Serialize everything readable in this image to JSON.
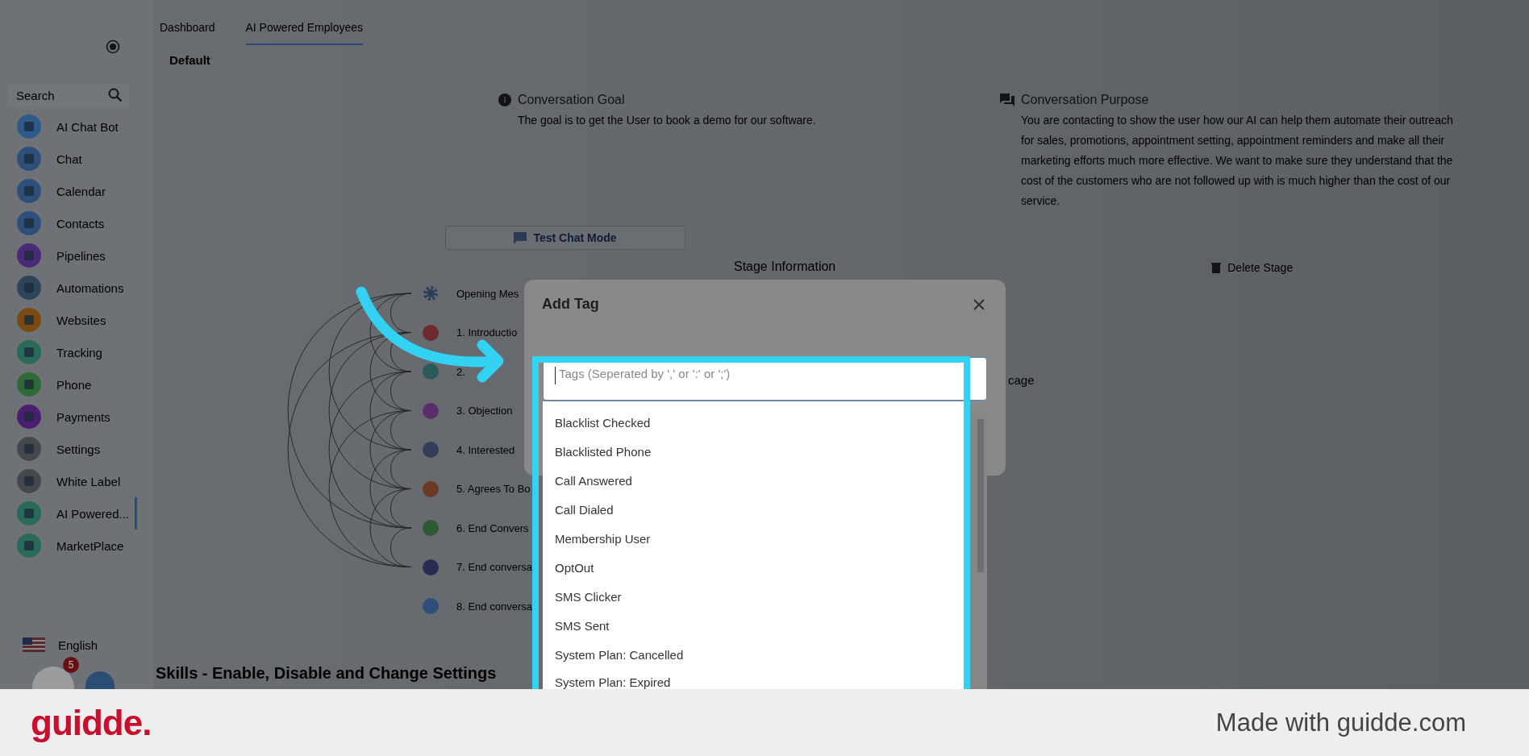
{
  "sidebar": {
    "search": {
      "placeholder": "Search"
    },
    "items": [
      {
        "label": "AI Chat Bot",
        "selected": false,
        "color": "#2d5a8a"
      },
      {
        "label": "Chat",
        "selected": false,
        "color": "#2e4f7a"
      },
      {
        "label": "Calendar",
        "selected": false,
        "color": "#2e4f7a"
      },
      {
        "label": "Contacts",
        "selected": false,
        "color": "#2e4f7a"
      },
      {
        "label": "Pipelines",
        "selected": false,
        "color": "#4a2a78"
      },
      {
        "label": "Automations",
        "selected": false,
        "color": "#2e4458"
      },
      {
        "label": "Websites",
        "selected": false,
        "color": "#7a4a10"
      },
      {
        "label": "Tracking",
        "selected": false,
        "color": "#2a6a5a"
      },
      {
        "label": "Phone",
        "selected": false,
        "color": "#2e6a35"
      },
      {
        "label": "Payments",
        "selected": false,
        "color": "#4a1e70"
      },
      {
        "label": "Settings",
        "selected": false,
        "color": "#45494d"
      },
      {
        "label": "White Label",
        "selected": false,
        "color": "#45494d"
      },
      {
        "label": "AI Powered...",
        "selected": true,
        "color": "#2a6a5a"
      },
      {
        "label": "MarketPlace",
        "selected": false,
        "color": "#2a6a5a"
      }
    ],
    "language": "English",
    "badge": "5"
  },
  "tabs": [
    {
      "label": "Dashboard",
      "selected": false
    },
    {
      "label": "AI Powered Employees",
      "selected": true
    }
  ],
  "subtitle": "Default",
  "goal": {
    "title": "Conversation Goal",
    "text": "The goal is to get the User to book a demo for our software."
  },
  "purpose": {
    "title": "Conversation Purpose",
    "text": "You are contacting to show the user how our AI can help them automate their outreach for sales, promotions, appointment setting, appointment reminders and make all their marketing efforts much more effective. We want to make sure they understand that the cost of the customers who are not followed up with is much higher than the cost of our service."
  },
  "test_button": "Test Chat Mode",
  "stage_info": "Stage Information",
  "delete_button": "Delete Stage",
  "side_text": "cage",
  "stages": {
    "header": "Opening Mes",
    "items": [
      {
        "label": "1. Introductio",
        "color": "#6e2a2c"
      },
      {
        "label": "2.",
        "color": "#2a5a5a"
      },
      {
        "label": "3. Objection",
        "color": "#5a2e6a"
      },
      {
        "label": "4. Interested",
        "color": "#333d5a"
      },
      {
        "label": "5. Agrees To Bo",
        "color": "#6a3a25"
      },
      {
        "label": "6. End Convers",
        "color": "#2e5a33"
      },
      {
        "label": "7. End conversa",
        "color": "#2a2c55"
      },
      {
        "label": "8. End conversa",
        "color": "#2e4f7a"
      }
    ]
  },
  "skills_heading": "Skills - Enable, Disable and Change Settings",
  "modal": {
    "title": "Add Tag",
    "tags_field": {
      "placeholder": "Tags (Seperated by ',' or ':' or ';')"
    },
    "options": [
      "Blacklist Checked",
      "Blacklisted Phone",
      "Call Answered",
      "Call Dialed",
      "Membership User",
      "OptOut",
      "SMS Clicker",
      "SMS Sent",
      "System Plan: Cancelled",
      "System Plan: Expired"
    ]
  },
  "footer": {
    "logo": "guidde.",
    "credit": "Made with guidde.com"
  }
}
